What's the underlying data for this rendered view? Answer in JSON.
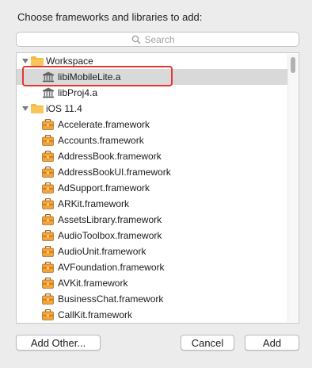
{
  "dialog": {
    "prompt": "Choose frameworks and libraries to add:",
    "search_placeholder": "Search"
  },
  "tree": {
    "workspace_group": "Workspace",
    "workspace_items": [
      "libiMobileLite.a",
      "libProj4.a"
    ],
    "sdk_group": "iOS 11.4",
    "frameworks": [
      "Accelerate.framework",
      "Accounts.framework",
      "AddressBook.framework",
      "AddressBookUI.framework",
      "AdSupport.framework",
      "ARKit.framework",
      "AssetsLibrary.framework",
      "AudioToolbox.framework",
      "AudioUnit.framework",
      "AVFoundation.framework",
      "AVKit.framework",
      "BusinessChat.framework",
      "CallKit.framework"
    ],
    "selected_item": "libiMobileLite.a"
  },
  "buttons": {
    "add_other": "Add Other...",
    "cancel": "Cancel",
    "add": "Add"
  },
  "colors": {
    "highlight_border": "#e5372f",
    "selection_bg": "#d9d9d9",
    "folder": "#f5b940"
  }
}
